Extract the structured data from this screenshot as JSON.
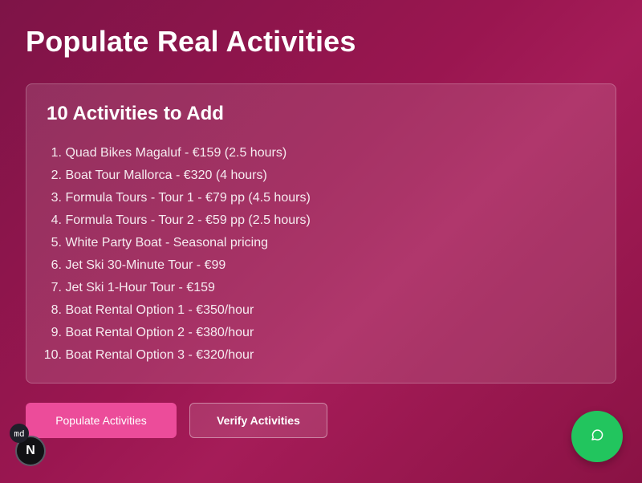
{
  "page": {
    "title": "Populate Real Activities"
  },
  "card": {
    "title": "10 Activities to Add",
    "items": [
      {
        "num": "1.",
        "text": "Quad Bikes Magaluf - €159 (2.5 hours)"
      },
      {
        "num": "2.",
        "text": "Boat Tour Mallorca - €320 (4 hours)"
      },
      {
        "num": "3.",
        "text": "Formula Tours - Tour 1 - €79 pp (4.5 hours)"
      },
      {
        "num": "4.",
        "text": "Formula Tours - Tour 2 - €59 pp (2.5 hours)"
      },
      {
        "num": "5.",
        "text": "White Party Boat - Seasonal pricing"
      },
      {
        "num": "6.",
        "text": "Jet Ski 30-Minute Tour - €99"
      },
      {
        "num": "7.",
        "text": "Jet Ski 1-Hour Tour - €159"
      },
      {
        "num": "8.",
        "text": "Boat Rental Option 1 - €350/hour"
      },
      {
        "num": "9.",
        "text": "Boat Rental Option 2 - €380/hour"
      },
      {
        "num": "10.",
        "text": "Boat Rental Option 3 - €320/hour"
      }
    ]
  },
  "actions": {
    "populate_label": "Populate Activities",
    "verify_label": "Verify Activities"
  },
  "overlays": {
    "md_badge": "md",
    "next_badge": "N",
    "chat_icon": "chat-bubble-icon"
  },
  "colors": {
    "background": "#9a1650",
    "primary_button": "#ec4c9a",
    "chat_fab": "#22c55e"
  }
}
